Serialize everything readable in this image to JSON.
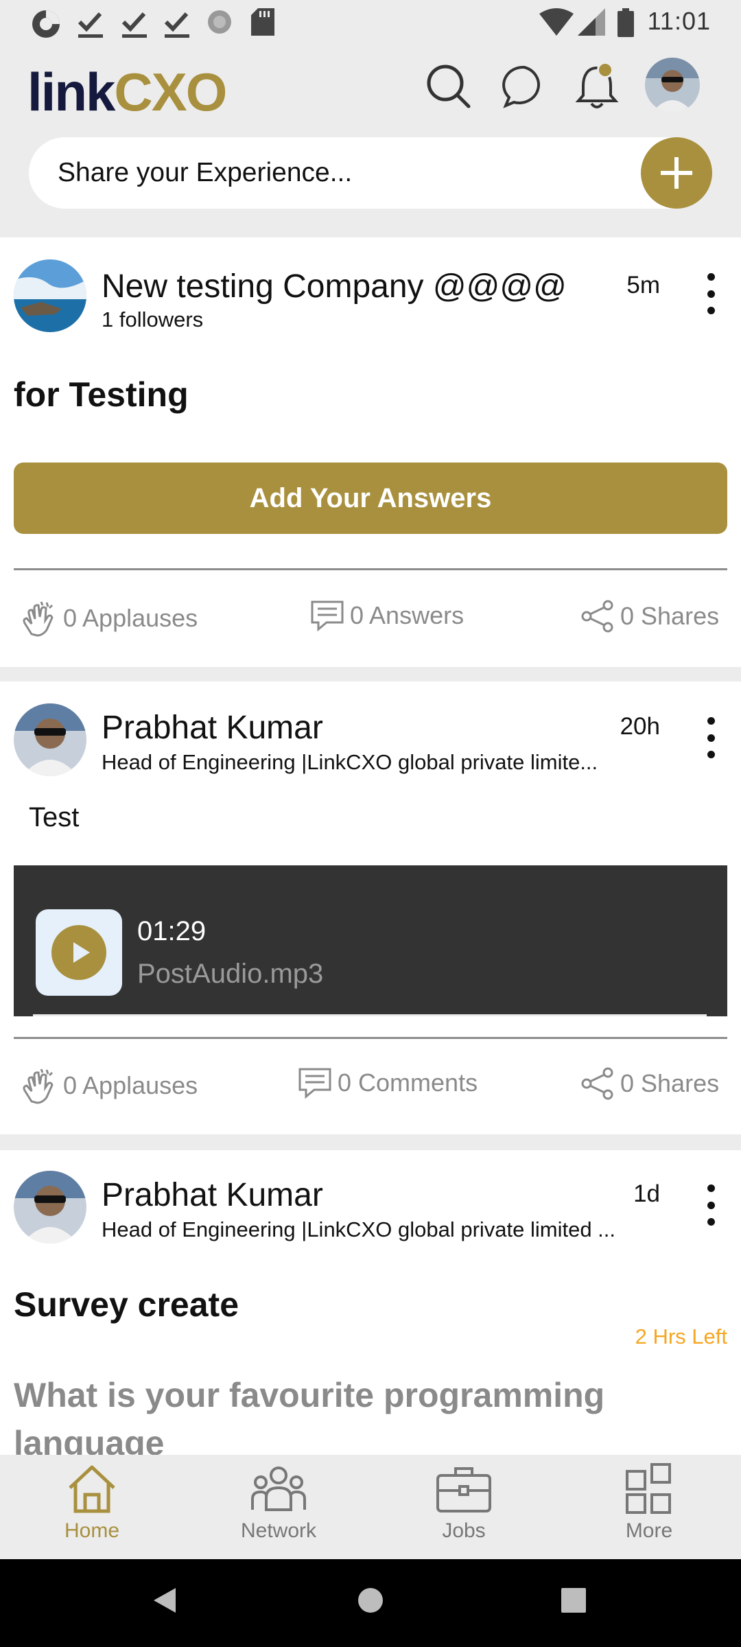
{
  "status_bar": {
    "time": "11:01"
  },
  "header": {
    "logo_part1": "link",
    "logo_part2": "CXO",
    "share_placeholder": "Share your Experience..."
  },
  "posts": [
    {
      "author": "New testing Company @@@@",
      "subtitle": "1 followers",
      "time": "5m",
      "title": "for Testing",
      "button_label": "Add Your Answers",
      "actions": [
        "0 Applauses",
        "0 Answers",
        "0 Shares"
      ]
    },
    {
      "author": "Prabhat Kumar",
      "subtitle": "Head of Engineering |LinkCXO global private limite...",
      "time": "20h",
      "body": "Test",
      "audio_duration": "01:29",
      "audio_file": "PostAudio.mp3",
      "actions": [
        "0 Applauses",
        "0 Comments",
        "0 Shares"
      ]
    },
    {
      "author": "Prabhat Kumar",
      "subtitle": "Head of Engineering |LinkCXO global private limited ...",
      "time": "1d",
      "title": "Survey create",
      "time_left": "2 Hrs Left",
      "question": "What is your favourite programming language"
    }
  ],
  "bottom_nav": [
    {
      "label": "Home",
      "icon": "home-icon",
      "active": true
    },
    {
      "label": "Network",
      "icon": "network-icon",
      "active": false
    },
    {
      "label": "Jobs",
      "icon": "briefcase-icon",
      "active": false
    },
    {
      "label": "More",
      "icon": "grid-icon",
      "active": false
    }
  ],
  "colors": {
    "accent": "#a8903e",
    "background": "#ececec",
    "orange": "#f5a623"
  }
}
